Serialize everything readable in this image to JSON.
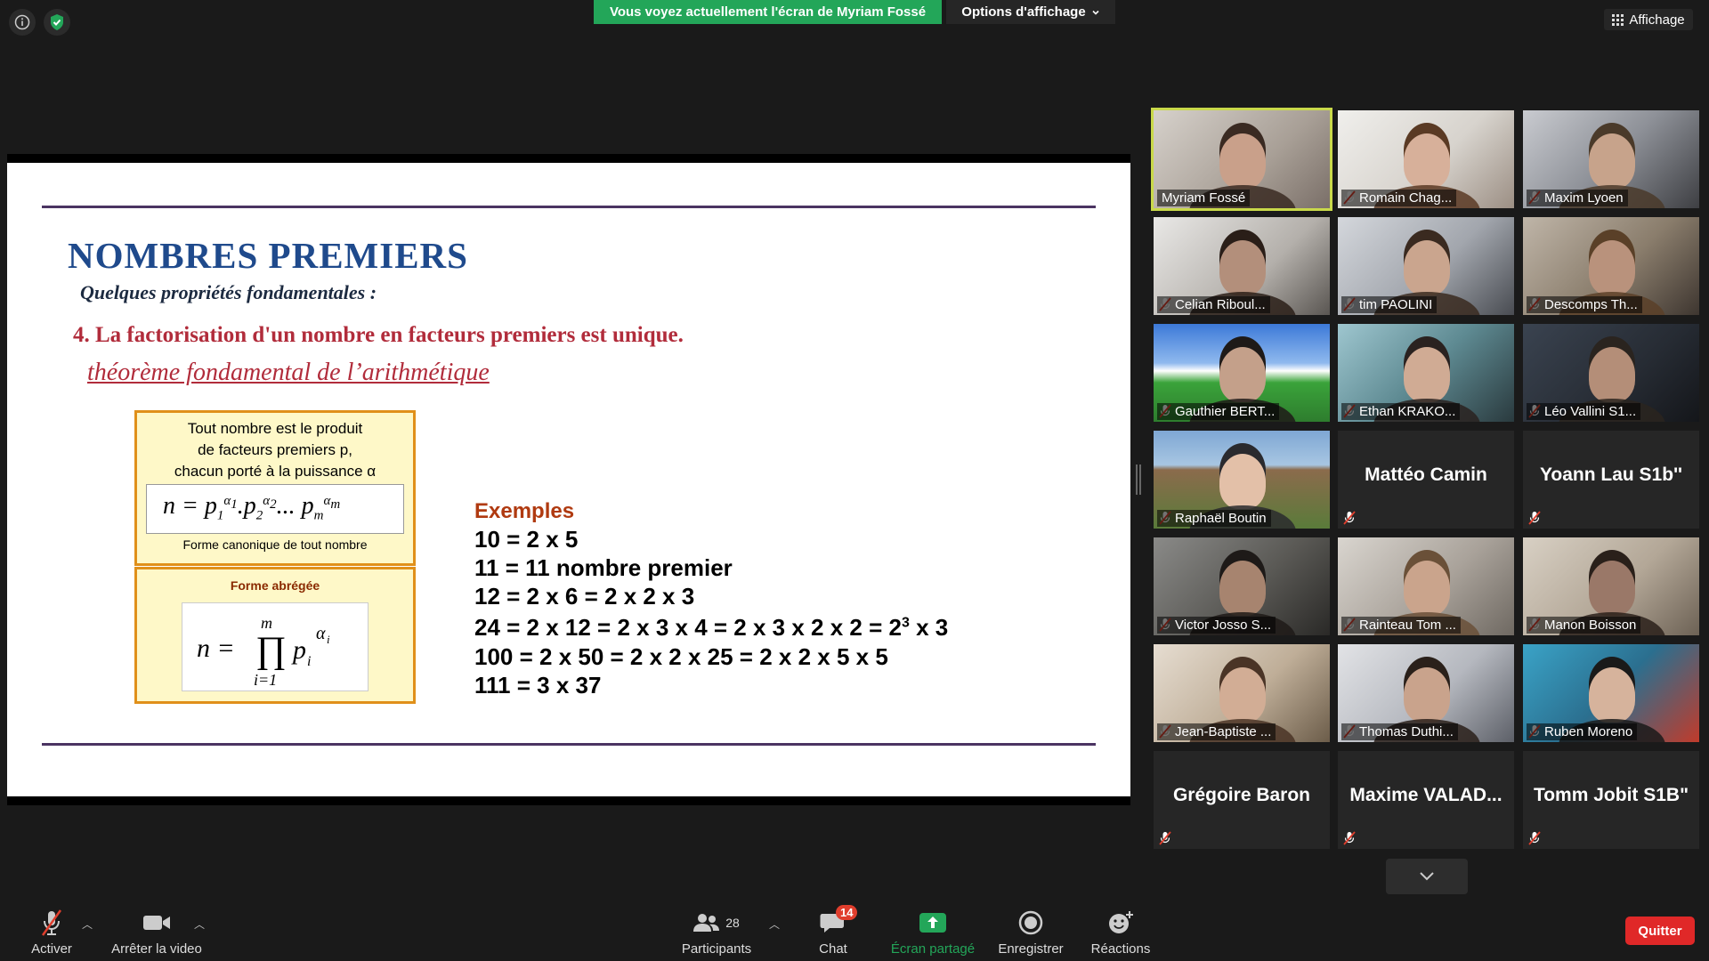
{
  "top": {
    "banner": "Vous voyez actuellement l'écran de Myriam Fossé",
    "view_options": "Options d'affichage",
    "affichage": "Affichage"
  },
  "slide": {
    "title": "NOMBRES PREMIERS",
    "subtitle": "Quelques propriétés fondamentales :",
    "point": "4. La factorisation d'un nombre en facteurs premiers est unique.",
    "theorem": "théorème fondamental de l’arithmétique",
    "box1_lines": [
      "Tout nombre est le produit",
      "de facteurs premiers p,",
      "chacun porté à la puissance α"
    ],
    "box1_caption": "Forme canonique de tout nombre",
    "box2_title": "Forme abrégée",
    "examples_title": "Exemples",
    "examples": [
      "10 = 2 x 5",
      "11 = 11 nombre premier",
      "12 = 2 x 6 = 2 x 2 x 3",
      "24 = 2 x 12 = 2 x 3 x 4  = 2 x 3 x 2 x 2 = 2",
      "100 = 2 x 50 = 2 x 2 x 25 = 2 x 2 x 5 x 5",
      "111 = 3 x 37"
    ],
    "example4_sup": "3",
    "example4_tail": " x 3"
  },
  "participants": [
    {
      "name": "Myriam Fossé",
      "video": true,
      "muted": false,
      "active": true
    },
    {
      "name": "Romain Chag...",
      "video": true,
      "muted": true
    },
    {
      "name": "Maxim Lyoen",
      "video": true,
      "muted": true
    },
    {
      "name": "Celian Riboul...",
      "video": true,
      "muted": true
    },
    {
      "name": "tim PAOLINI",
      "video": true,
      "muted": true
    },
    {
      "name": "Descomps Th...",
      "video": true,
      "muted": true
    },
    {
      "name": "Gauthier BERT...",
      "video": true,
      "muted": true
    },
    {
      "name": "Ethan KRAKO...",
      "video": true,
      "muted": true
    },
    {
      "name": "Léo Vallini S1...",
      "video": true,
      "muted": true
    },
    {
      "name": "Raphaël Boutin",
      "video": true,
      "muted": true
    },
    {
      "name": "Mattéo Camin",
      "video": false,
      "muted": true
    },
    {
      "name": "Yoann Lau S1b''",
      "video": false,
      "muted": true
    },
    {
      "name": "Victor Josso S...",
      "video": true,
      "muted": true
    },
    {
      "name": "Rainteau Tom ...",
      "video": true,
      "muted": true
    },
    {
      "name": "Manon Boisson",
      "video": true,
      "muted": true
    },
    {
      "name": "Jean-Baptiste ...",
      "video": true,
      "muted": true
    },
    {
      "name": "Thomas Duthi...",
      "video": true,
      "muted": true
    },
    {
      "name": "Ruben Moreno",
      "video": true,
      "muted": true
    },
    {
      "name": "Grégoire Baron",
      "video": false,
      "muted": true
    },
    {
      "name": "Maxime  VALAD...",
      "video": false,
      "muted": true
    },
    {
      "name": "Tomm Jobit S1B\"",
      "video": false,
      "muted": true
    }
  ],
  "toolbar": {
    "mic_label": "Activer",
    "video_label": "Arrêter la video",
    "participants_label": "Participants",
    "participants_count": "28",
    "chat_label": "Chat",
    "chat_badge": "14",
    "share_label": "Écran partagé",
    "record_label": "Enregistrer",
    "reactions_label": "Réactions",
    "quit_label": "Quitter"
  },
  "colors": {
    "share_green": "#23a659",
    "quit_red": "#e02828",
    "active_speaker": "#c9d94a",
    "slide_title_blue": "#1f4a8c",
    "slide_red": "#b12c3b"
  }
}
